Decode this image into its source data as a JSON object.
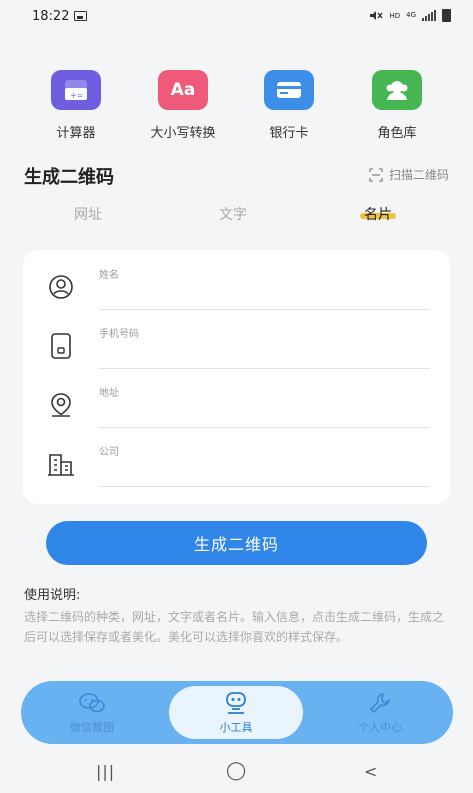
{
  "status_bar": {
    "time": "18:22",
    "hd": "HD",
    "network": "4G"
  },
  "tools": [
    {
      "label": "计算器",
      "icon": "calculator-icon",
      "color": "#6f5fe0"
    },
    {
      "label": "大小写转换",
      "icon": "case-convert-icon",
      "color": "#ef5a7a",
      "glyph": "Aa"
    },
    {
      "label": "银行卡",
      "icon": "bank-card-icon",
      "color": "#3d8ee8"
    },
    {
      "label": "角色库",
      "icon": "role-library-icon",
      "color": "#46b653"
    }
  ],
  "section": {
    "title": "生成二维码",
    "scan_label": "扫描二维码"
  },
  "tabs": [
    {
      "label": "网址",
      "active": false
    },
    {
      "label": "文字",
      "active": false
    },
    {
      "label": "名片",
      "active": true
    }
  ],
  "form": {
    "fields": [
      {
        "label": "姓名",
        "icon": "user-circle-icon",
        "value": ""
      },
      {
        "label": "手机号码",
        "icon": "phone-icon",
        "value": ""
      },
      {
        "label": "地址",
        "icon": "location-icon",
        "value": ""
      },
      {
        "label": "公司",
        "icon": "building-icon",
        "value": ""
      }
    ]
  },
  "generate_button": "生成二维码",
  "usage": {
    "title": "使用说明:",
    "text": "选择二维码的种类，网址，文字或者名片。输入信息，点击生成二维码，生成之后可以选择保存或者美化。美化可以选择你喜欢的样式保存。"
  },
  "bottom_nav": [
    {
      "label": "微信截图",
      "icon": "chat-screenshot-icon",
      "active": false
    },
    {
      "label": "小工具",
      "icon": "robot-icon",
      "active": true
    },
    {
      "label": "个人中心",
      "icon": "wrench-icon",
      "active": false
    }
  ],
  "system_nav": {
    "recent": "|||",
    "home": "◯",
    "back": "<"
  },
  "colors": {
    "accent": "#2f86e8",
    "tab_highlight": "#f5c23b",
    "nav_bg": "#69b2f2"
  }
}
